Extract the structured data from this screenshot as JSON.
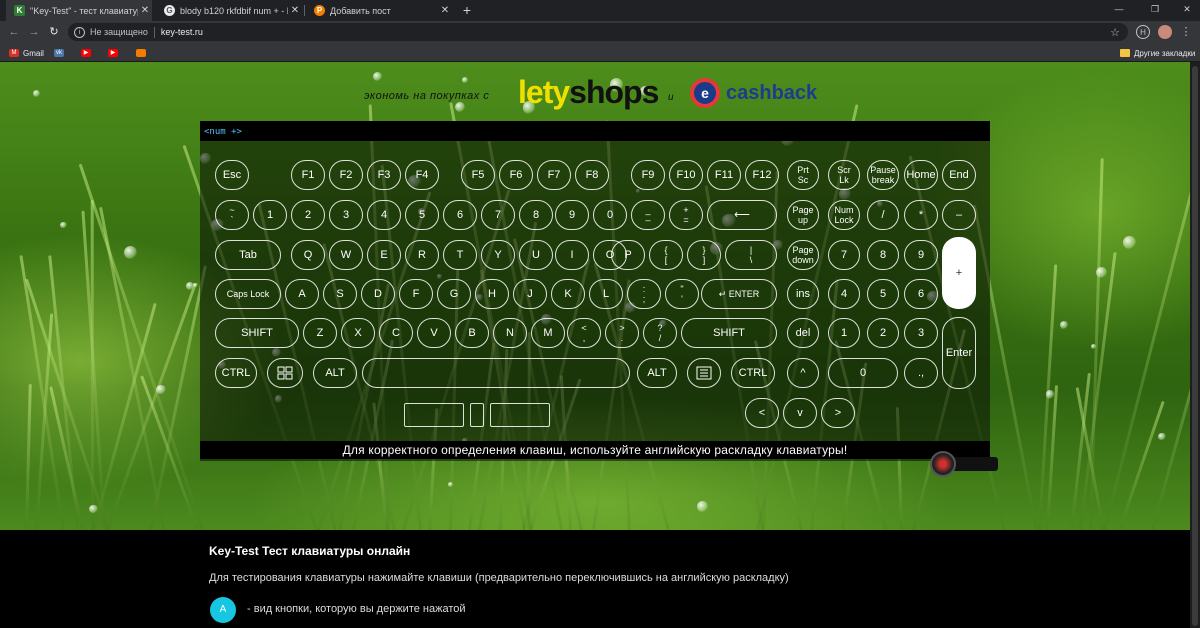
{
  "tabs": [
    {
      "title": "\"Key-Test\" - тест клавиатуры он",
      "favicon": "K",
      "active": true
    },
    {
      "title": "blody b120 rkfdbif num + - Пои",
      "favicon": "G",
      "active": false
    },
    {
      "title": "Добавить пост",
      "favicon": "P",
      "active": false
    }
  ],
  "toolbar": {
    "security": "Не защищено",
    "url": "key-test.ru"
  },
  "bookmarks": [
    {
      "label": "Gmail",
      "icon": "gmail-icon",
      "color": "#d93025"
    },
    {
      "label": "",
      "icon": "vk-icon",
      "color": "#4a76a8"
    },
    {
      "label": "",
      "icon": "youtube-icon",
      "color": "#ff0000"
    },
    {
      "label": "",
      "icon": "youtube-icon",
      "color": "#ff0000"
    },
    {
      "label": "",
      "icon": "orange-icon",
      "color": "#f57c00"
    }
  ],
  "other_bookmarks": "Другие закладки",
  "ad": {
    "slogan": "экономь на покупках с",
    "brand1_prefix": "lety",
    "brand1_suffix": "shops",
    "and": "и",
    "brand2": "cashback",
    "brand2_logo": "е"
  },
  "keyboard": {
    "header": "<num +>",
    "note": "Для корректного определения клавиш, используйте английскую раскладку клавиатуры!",
    "keys": [
      {
        "id": "esc",
        "label": "Esc"
      },
      {
        "id": "f1",
        "label": "F1"
      },
      {
        "id": "f2",
        "label": "F2"
      },
      {
        "id": "f3",
        "label": "F3"
      },
      {
        "id": "f4",
        "label": "F4"
      },
      {
        "id": "f5",
        "label": "F5"
      },
      {
        "id": "f6",
        "label": "F6"
      },
      {
        "id": "f7",
        "label": "F7"
      },
      {
        "id": "f8",
        "label": "F8"
      },
      {
        "id": "f9",
        "label": "F9"
      },
      {
        "id": "f10",
        "label": "F10"
      },
      {
        "id": "f11",
        "label": "F11"
      },
      {
        "id": "f12",
        "label": "F12"
      },
      {
        "id": "prtsc",
        "label": "Prt\nSc"
      },
      {
        "id": "scrlk",
        "label": "Scr\nLk"
      },
      {
        "id": "pause",
        "label": "Pause\nbreak"
      },
      {
        "id": "home",
        "label": "Home"
      },
      {
        "id": "end",
        "label": "End"
      },
      {
        "id": "tilde",
        "label": "~\n`"
      },
      {
        "id": "d1",
        "label": "1"
      },
      {
        "id": "d2",
        "label": "2"
      },
      {
        "id": "d3",
        "label": "3"
      },
      {
        "id": "d4",
        "label": "4"
      },
      {
        "id": "d5",
        "label": "5"
      },
      {
        "id": "d6",
        "label": "6"
      },
      {
        "id": "d7",
        "label": "7"
      },
      {
        "id": "d8",
        "label": "8"
      },
      {
        "id": "d9",
        "label": "9"
      },
      {
        "id": "d0",
        "label": "0"
      },
      {
        "id": "minus",
        "label": "_\n–"
      },
      {
        "id": "equal",
        "label": "+\n="
      },
      {
        "id": "backspace",
        "label": "⟵"
      },
      {
        "id": "pgup",
        "label": "Page\nup"
      },
      {
        "id": "numlock",
        "label": "Num\nLock"
      },
      {
        "id": "ndiv",
        "label": "/"
      },
      {
        "id": "nmul",
        "label": "*"
      },
      {
        "id": "nsub",
        "label": "–"
      },
      {
        "id": "tab",
        "label": "Tab"
      },
      {
        "id": "q",
        "label": "Q"
      },
      {
        "id": "w",
        "label": "W"
      },
      {
        "id": "e",
        "label": "E"
      },
      {
        "id": "r",
        "label": "R"
      },
      {
        "id": "t",
        "label": "T"
      },
      {
        "id": "y",
        "label": "Y"
      },
      {
        "id": "u",
        "label": "U"
      },
      {
        "id": "i",
        "label": "I"
      },
      {
        "id": "o",
        "label": "O"
      },
      {
        "id": "p",
        "label": "P"
      },
      {
        "id": "lbr",
        "label": "{\n["
      },
      {
        "id": "rbr",
        "label": "}\n]"
      },
      {
        "id": "bslash",
        "label": "|\n\\"
      },
      {
        "id": "pgdn",
        "label": "Page\ndown"
      },
      {
        "id": "n7",
        "label": "7"
      },
      {
        "id": "n8",
        "label": "8"
      },
      {
        "id": "n9",
        "label": "9"
      },
      {
        "id": "nadd",
        "label": "+"
      },
      {
        "id": "caps",
        "label": "Caps Lock"
      },
      {
        "id": "a",
        "label": "A"
      },
      {
        "id": "s",
        "label": "S"
      },
      {
        "id": "d",
        "label": "D"
      },
      {
        "id": "f",
        "label": "F"
      },
      {
        "id": "g",
        "label": "G"
      },
      {
        "id": "h",
        "label": "H"
      },
      {
        "id": "j",
        "label": "J"
      },
      {
        "id": "k",
        "label": "K"
      },
      {
        "id": "l",
        "label": "L"
      },
      {
        "id": "semi",
        "label": ":\n;"
      },
      {
        "id": "quote",
        "label": "\"\n'"
      },
      {
        "id": "enter",
        "label": "↵ ENTER"
      },
      {
        "id": "ins",
        "label": "ins"
      },
      {
        "id": "n4",
        "label": "4"
      },
      {
        "id": "n5",
        "label": "5"
      },
      {
        "id": "n6",
        "label": "6"
      },
      {
        "id": "lshift",
        "label": "SHIFT"
      },
      {
        "id": "z",
        "label": "Z"
      },
      {
        "id": "x",
        "label": "X"
      },
      {
        "id": "c",
        "label": "C"
      },
      {
        "id": "v",
        "label": "V"
      },
      {
        "id": "b",
        "label": "B"
      },
      {
        "id": "n",
        "label": "N"
      },
      {
        "id": "m",
        "label": "M"
      },
      {
        "id": "comma",
        "label": "<\n,"
      },
      {
        "id": "period",
        "label": ">\n."
      },
      {
        "id": "slash",
        "label": "?\n/"
      },
      {
        "id": "rshift",
        "label": "SHIFT"
      },
      {
        "id": "del",
        "label": "del"
      },
      {
        "id": "n1",
        "label": "1"
      },
      {
        "id": "n2",
        "label": "2"
      },
      {
        "id": "n3",
        "label": "3"
      },
      {
        "id": "nenter",
        "label": "Enter"
      },
      {
        "id": "lctrl",
        "label": "CTRL"
      },
      {
        "id": "win",
        "label": ""
      },
      {
        "id": "lalt",
        "label": "ALT"
      },
      {
        "id": "space",
        "label": ""
      },
      {
        "id": "ralt",
        "label": "ALT"
      },
      {
        "id": "menu",
        "label": ""
      },
      {
        "id": "rctrl",
        "label": "CTRL"
      },
      {
        "id": "up",
        "label": "^"
      },
      {
        "id": "n0",
        "label": "0"
      },
      {
        "id": "ndot",
        "label": ".,"
      },
      {
        "id": "mouse1",
        "label": ""
      },
      {
        "id": "mouse2",
        "label": ""
      },
      {
        "id": "mouse3",
        "label": ""
      },
      {
        "id": "left",
        "label": "<"
      },
      {
        "id": "down",
        "label": "v"
      },
      {
        "id": "right",
        "label": ">"
      }
    ],
    "pressed": [
      "nadd"
    ]
  },
  "content": {
    "title": "Key-Test Тест клавиатуры онлайн",
    "instruction": "Для тестирования клавиатуры нажимайте клавиши (предварительно переключившись на английскую раскладку)",
    "legend_key": "A",
    "legend_text": "- вид кнопки, которую вы держите нажатой"
  }
}
